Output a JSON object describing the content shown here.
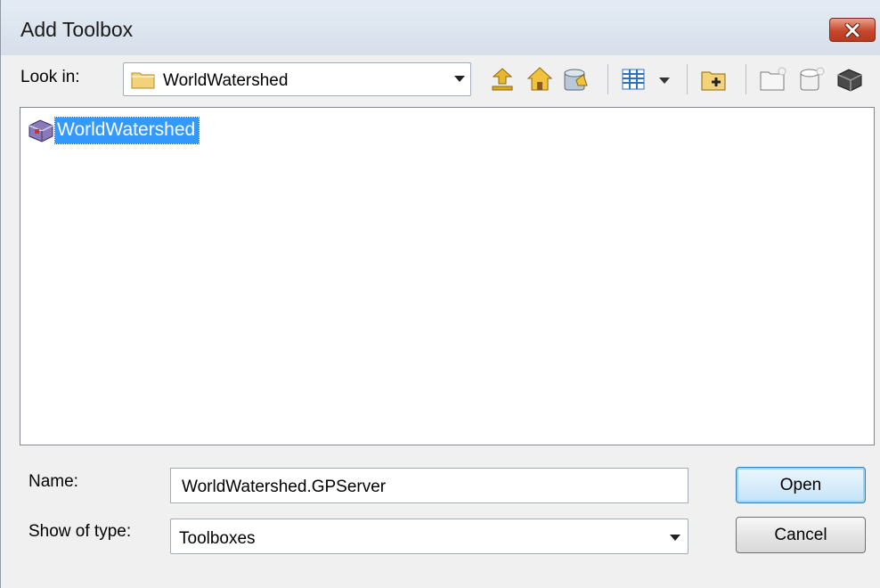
{
  "window": {
    "title": "Add Toolbox"
  },
  "lookin": {
    "label": "Look in:",
    "value": "WorldWatershed"
  },
  "toolbar": {
    "icons": [
      "up-one-level-icon",
      "home-icon",
      "go-to-default-geodatabase-icon",
      "view-menu-icon",
      "connect-to-folder-icon",
      "new-folder-icon",
      "new-geodatabase-icon",
      "new-toolbox-icon"
    ]
  },
  "list": {
    "items": [
      {
        "label": "WorldWatershed",
        "icon": "toolbox-icon",
        "selected": true
      }
    ]
  },
  "name": {
    "label": "Name:",
    "value": "WorldWatershed.GPServer"
  },
  "type": {
    "label": "Show of type:",
    "value": "Toolboxes"
  },
  "buttons": {
    "open": "Open",
    "cancel": "Cancel"
  },
  "colors": {
    "selection": "#3399ff",
    "close": "#c7472b",
    "default_button_border": "#3c7fb1"
  }
}
